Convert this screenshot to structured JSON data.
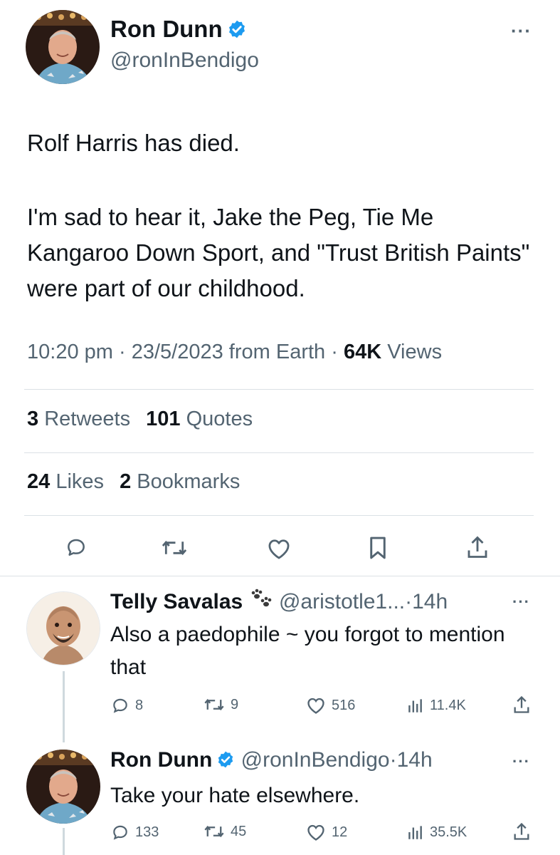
{
  "tweet": {
    "author_name": "Ron Dunn",
    "author_handle": "@ronInBendigo",
    "text_line1": "Rolf Harris has died.",
    "text_paragraph2": "I'm sad to hear it, Jake the Peg, Tie Me Kangaroo Down Sport, and \"Trust British Paints\" were part of our childhood.",
    "time": "10:20 pm",
    "date": "23/5/2023",
    "source": "from Earth",
    "views_count": "64K",
    "views_label": "Views",
    "separator": "·",
    "retweets_count": "3",
    "retweets_label": "Retweets",
    "quotes_count": "101",
    "quotes_label": "Quotes",
    "likes_count": "24",
    "likes_label": "Likes",
    "bookmarks_count": "2",
    "bookmarks_label": "Bookmarks",
    "more_label": "···"
  },
  "replies": [
    {
      "author_name": "Telly Savalas",
      "author_handle": "@aristotle1...",
      "age": "14h",
      "separator": "·",
      "text": "Also a paedophile ~ you forgot to mention that",
      "reply_count": "8",
      "retweet_count": "9",
      "like_count": "516",
      "view_count": "11.4K",
      "more_label": "···"
    },
    {
      "author_name": "Ron Dunn",
      "author_handle": "@ronInBendigo",
      "age": "14h",
      "separator": "·",
      "text": "Take your hate elsewhere.",
      "reply_count": "133",
      "retweet_count": "45",
      "like_count": "12",
      "view_count": "35.5K",
      "more_label": "···"
    }
  ],
  "icons": {
    "verified": "verified-badge-icon",
    "reply": "reply-bubble-icon",
    "retweet": "retweet-icon",
    "like": "heart-icon",
    "bookmark": "bookmark-icon",
    "share": "share-icon",
    "views": "bar-chart-icon",
    "paw": "paw-prints-icon"
  },
  "colors": {
    "accent": "#1d9bf0",
    "text": "#0f1419",
    "muted": "#536471",
    "divider": "#dbe1e5"
  }
}
